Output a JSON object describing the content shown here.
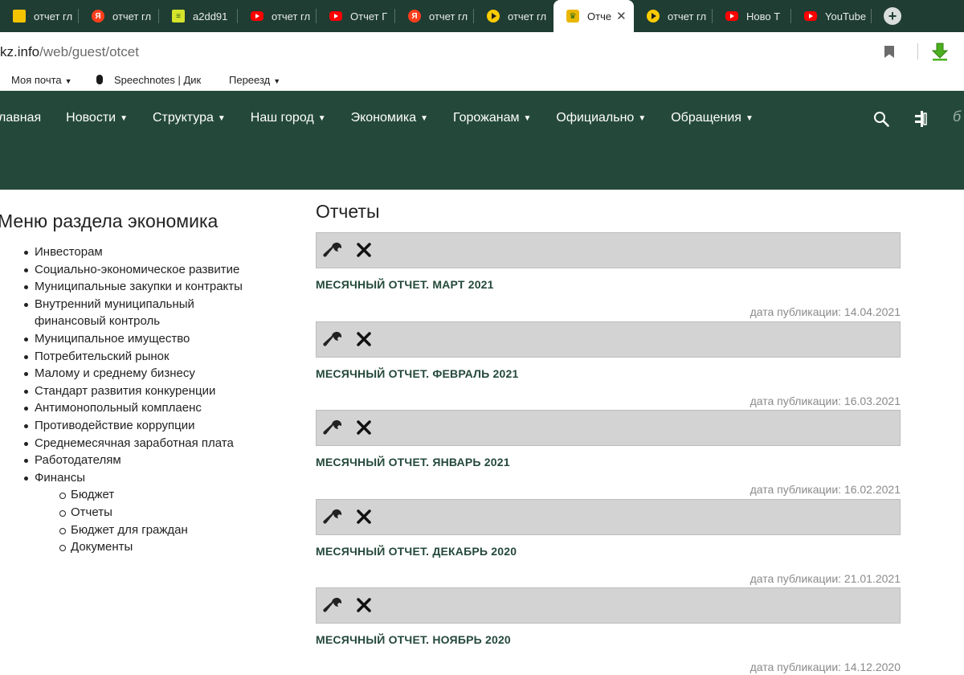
{
  "browser": {
    "tabs": [
      {
        "title": "отчет гл",
        "icon": "yellow-image-icon"
      },
      {
        "title": "отчет гл",
        "icon": "yandex-icon"
      },
      {
        "title": "a2dd91",
        "icon": "notepad-icon"
      },
      {
        "title": "отчет гл",
        "icon": "youtube-icon"
      },
      {
        "title": "Отчет Г",
        "icon": "youtube-icon"
      },
      {
        "title": "отчет гл",
        "icon": "yandex-icon"
      },
      {
        "title": "отчет гл",
        "icon": "play-icon"
      },
      {
        "title": "Отче",
        "icon": "city-crest-icon",
        "active": true
      },
      {
        "title": "отчет гл",
        "icon": "play-icon"
      },
      {
        "title": "Ново Т",
        "icon": "youtube-icon"
      },
      {
        "title": "YouTube",
        "icon": "youtube-icon"
      }
    ],
    "url_host": "kz.info",
    "url_path": "/web/guest/otcet",
    "bookmarks": [
      {
        "label": "Моя почта",
        "has_caret": true
      },
      {
        "label": "Speechnotes | Дик",
        "icon": "microphone-icon"
      },
      {
        "label": "Переезд",
        "has_caret": true
      }
    ]
  },
  "nav": {
    "items": [
      {
        "label": "лавная",
        "has_caret": false
      },
      {
        "label": "Новости",
        "has_caret": true
      },
      {
        "label": "Структура",
        "has_caret": true
      },
      {
        "label": "Наш город",
        "has_caret": true
      },
      {
        "label": "Экономика",
        "has_caret": true
      },
      {
        "label": "Горожанам",
        "has_caret": true
      },
      {
        "label": "Официально",
        "has_caret": true
      },
      {
        "label": "Обращения",
        "has_caret": true
      }
    ],
    "partial_icon": "б"
  },
  "side": {
    "title": "Меню раздела экономика",
    "items": [
      {
        "label": "Инвесторам",
        "level": 1
      },
      {
        "label": "Социально-экономическое развитие",
        "level": 1
      },
      {
        "label": "Муниципальные закупки и контракты",
        "level": 1
      },
      {
        "label": "Внутренний муниципальный",
        "level": 1
      },
      {
        "label": "финансовый контроль",
        "level": 0
      },
      {
        "label": "Муниципальное имущество",
        "level": 1
      },
      {
        "label": "Потребительский рынок",
        "level": 1
      },
      {
        "label": "Малому и среднему бизнесу",
        "level": 1
      },
      {
        "label": "Стандарт развития конкуренции",
        "level": 1
      },
      {
        "label": "Антимонопольный комплаенс",
        "level": 1
      },
      {
        "label": "Противодействие коррупции",
        "level": 1
      },
      {
        "label": "Среднемесячная заработная плата",
        "level": 1
      },
      {
        "label": "Работодателям",
        "level": 1
      },
      {
        "label": "Финансы",
        "level": 1
      },
      {
        "label": "Бюджет",
        "level": 2
      },
      {
        "label": "Отчеты",
        "level": 2
      },
      {
        "label": "Бюджет для граждан",
        "level": 2
      },
      {
        "label": "Документы",
        "level": 2
      }
    ]
  },
  "main": {
    "title": "Отчеты",
    "reports": [
      {
        "title": "МЕСЯЧНЫЙ ОТЧЕТ. МАРТ 2021",
        "date": "дата публикации: 14.04.2021"
      },
      {
        "title": "МЕСЯЧНЫЙ ОТЧЕТ. ФЕВРАЛЬ 2021",
        "date": "дата публикации: 16.03.2021"
      },
      {
        "title": "МЕСЯЧНЫЙ ОТЧЕТ. ЯНВАРЬ 2021",
        "date": "дата публикации: 16.02.2021"
      },
      {
        "title": "МЕСЯЧНЫЙ ОТЧЕТ. ДЕКАБРЬ 2020",
        "date": "дата публикации: 21.01.2021"
      },
      {
        "title": "МЕСЯЧНЫЙ ОТЧЕТ. НОЯБРЬ 2020",
        "date": "дата публикации: 14.12.2020"
      }
    ]
  },
  "colors": {
    "tabstrip": "#1f3d33",
    "header": "#24493a",
    "report_title": "#24493a",
    "toolbar": "#d3d3d3",
    "date_text": "#8a8a8a"
  }
}
